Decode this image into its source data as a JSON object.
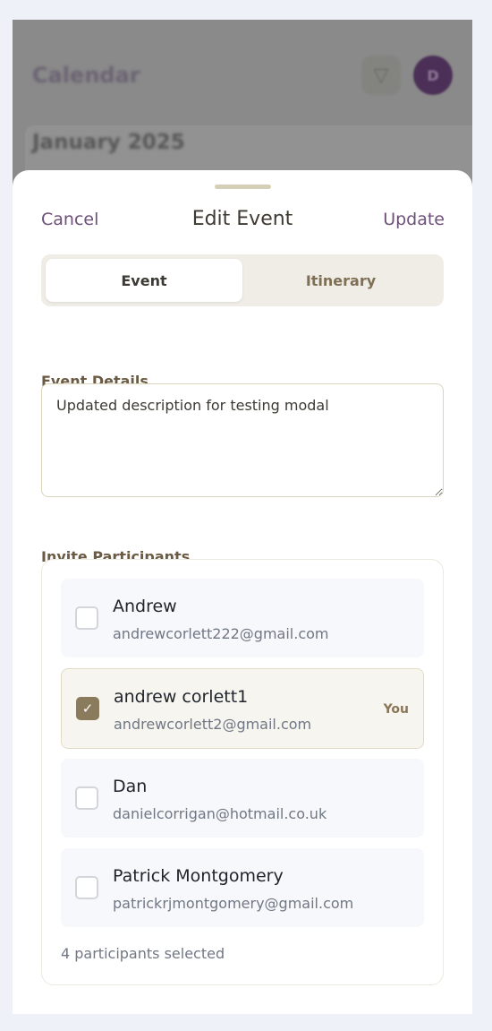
{
  "background": {
    "title": "Calendar",
    "month": "January 2025",
    "avatar_initial": "D"
  },
  "modal": {
    "cancel_label": "Cancel",
    "title": "Edit Event",
    "update_label": "Update",
    "tabs": [
      {
        "label": "Event",
        "active": true
      },
      {
        "label": "Itinerary",
        "active": false
      }
    ],
    "details_label": "Event Details",
    "details_value": "Updated description for testing modal",
    "invite_label": "Invite Participants",
    "participants": [
      {
        "name": "Andrew",
        "email": "andrewcorlett222@gmail.com",
        "checked": false,
        "badge": ""
      },
      {
        "name": "andrew corlett1",
        "email": "andrewcorlett2@gmail.com",
        "checked": true,
        "badge": "You"
      },
      {
        "name": "Dan",
        "email": "danielcorrigan@hotmail.co.uk",
        "checked": false,
        "badge": ""
      },
      {
        "name": "Patrick Montgomery",
        "email": "patrickrjmontgomery@gmail.com",
        "checked": false,
        "badge": ""
      }
    ],
    "count_text": "4 participants selected"
  },
  "colors": {
    "accent": "#6d4f79",
    "checkbox_checked": "#8a7b5d",
    "tab_bg": "#efede6"
  }
}
